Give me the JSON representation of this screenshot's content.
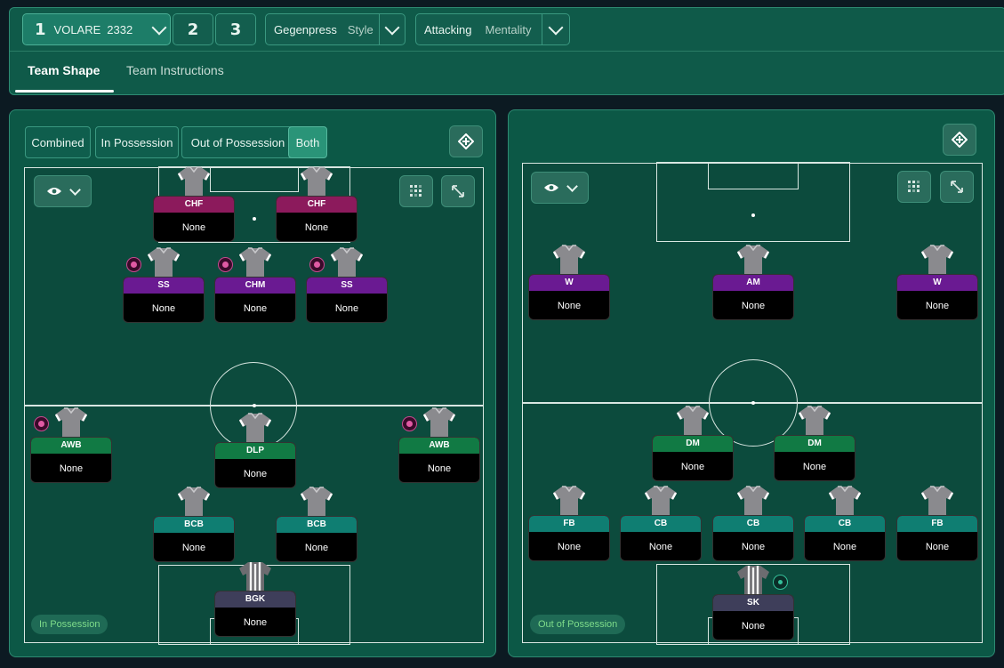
{
  "top_bar": {
    "tactic_slot": "1",
    "tactic_name": "VOLARE",
    "tactic_formation": "2332",
    "slot_2": "2",
    "slot_3": "3",
    "style_value": "Gegenpress",
    "style_label": "Style",
    "mentality_value": "Attacking",
    "mentality_label": "Mentality",
    "tabs": [
      "Team Shape",
      "Team Instructions"
    ]
  },
  "left_panel": {
    "segments": [
      "Combined",
      "In Possession",
      "Out of Possession",
      "Both"
    ],
    "selected_segment": "Both",
    "phase_label": "In Possession",
    "players": [
      {
        "role": "CHF",
        "duty": "None",
        "color": "magenta"
      },
      {
        "role": "CHF",
        "duty": "None",
        "color": "magenta"
      },
      {
        "role": "SS",
        "duty": "None",
        "color": "purple"
      },
      {
        "role": "CHM",
        "duty": "None",
        "color": "purple"
      },
      {
        "role": "SS",
        "duty": "None",
        "color": "purple"
      },
      {
        "role": "AWB",
        "duty": "None",
        "color": "green"
      },
      {
        "role": "DLP",
        "duty": "None",
        "color": "green"
      },
      {
        "role": "AWB",
        "duty": "None",
        "color": "green"
      },
      {
        "role": "BCB",
        "duty": "None",
        "color": "teal"
      },
      {
        "role": "BCB",
        "duty": "None",
        "color": "teal"
      },
      {
        "role": "BGK",
        "duty": "None",
        "color": "slate"
      }
    ]
  },
  "right_panel": {
    "phase_label": "Out of Possession",
    "players": [
      {
        "role": "W",
        "duty": "None",
        "color": "purple"
      },
      {
        "role": "AM",
        "duty": "None",
        "color": "purple"
      },
      {
        "role": "W",
        "duty": "None",
        "color": "purple"
      },
      {
        "role": "DM",
        "duty": "None",
        "color": "green"
      },
      {
        "role": "DM",
        "duty": "None",
        "color": "green"
      },
      {
        "role": "FB",
        "duty": "None",
        "color": "teal"
      },
      {
        "role": "CB",
        "duty": "None",
        "color": "teal"
      },
      {
        "role": "CB",
        "duty": "None",
        "color": "teal"
      },
      {
        "role": "CB",
        "duty": "None",
        "color": "teal"
      },
      {
        "role": "FB",
        "duty": "None",
        "color": "teal"
      },
      {
        "role": "SK",
        "duty": "None",
        "color": "slate"
      }
    ]
  }
}
